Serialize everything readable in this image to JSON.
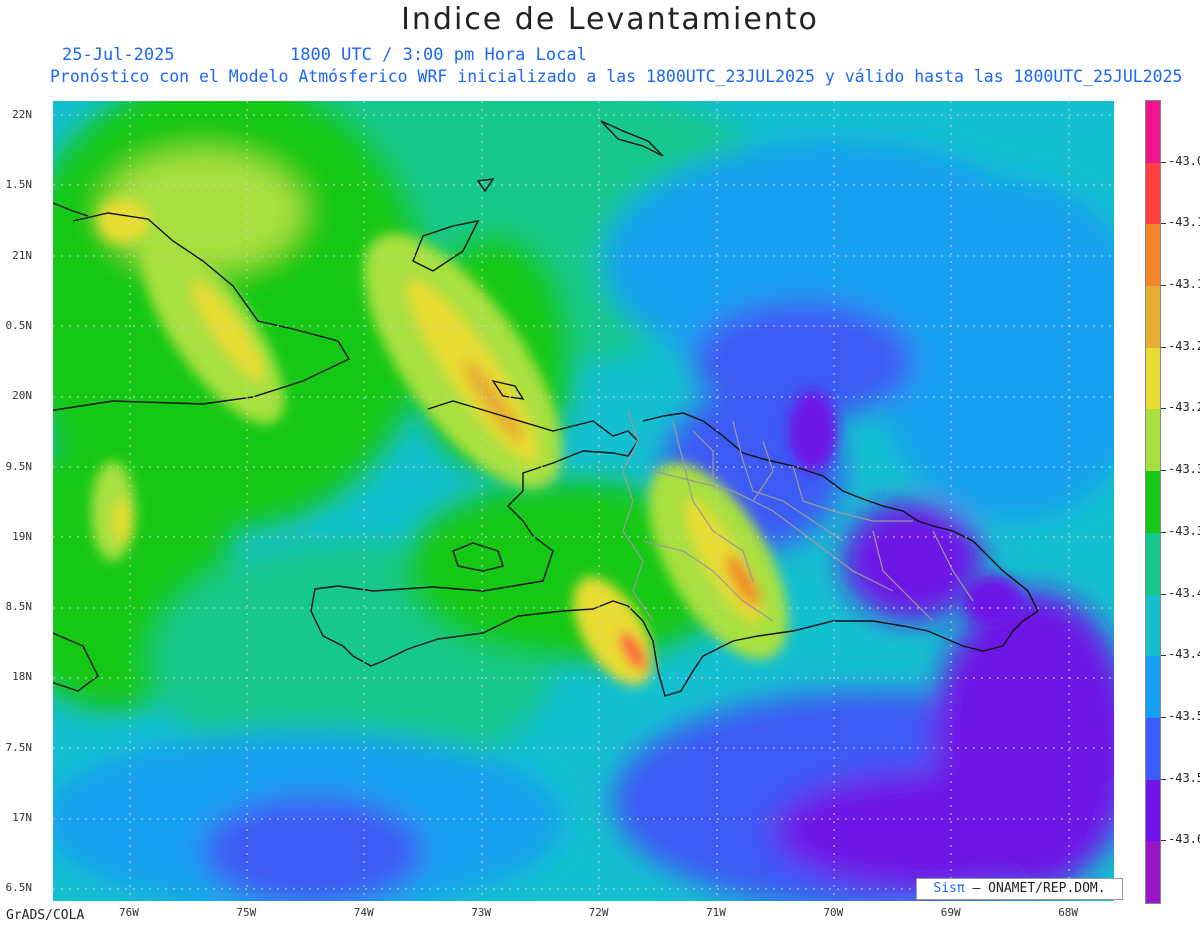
{
  "header": {
    "title": "Indice de Levantamiento",
    "date": "25-Jul-2025",
    "time": "1800 UTC / 3:00 pm Hora Local",
    "description": "Pronóstico con el Modelo Atmósferico WRF inicializado a las 1800UTC_23JUL2025 y válido hasta las  1800UTC_25JUL2025"
  },
  "axes": {
    "lat_labels": [
      "22N",
      "1.5N",
      "21N",
      "0.5N",
      "20N",
      "9.5N",
      "19N",
      "8.5N",
      "18N",
      "7.5N",
      "17N",
      "6.5N"
    ],
    "lon_labels": [
      "76W",
      "75W",
      "74W",
      "73W",
      "72W",
      "71W",
      "70W",
      "69W",
      "68W"
    ]
  },
  "colorbar": {
    "labels": [
      "-43.0",
      "-43.1",
      "-43.1",
      "-43.2",
      "-43.2",
      "-43.3",
      "-43.3",
      "-43.4",
      "-43.4",
      "-43.5",
      "-43.5",
      "-43.6"
    ],
    "colors": [
      "#f0148c",
      "#ff4040",
      "#f5852a",
      "#e6ad32",
      "#e8dc32",
      "#a8e040",
      "#14c814",
      "#14c88c",
      "#14c0d0",
      "#14a0f0",
      "#3c5af5",
      "#6e14e6",
      "#9a14c8"
    ]
  },
  "credit": {
    "logo": "Sisπ",
    "text": "– ONAMET/REP.DOM."
  },
  "footer": "GrADS/COLA"
}
